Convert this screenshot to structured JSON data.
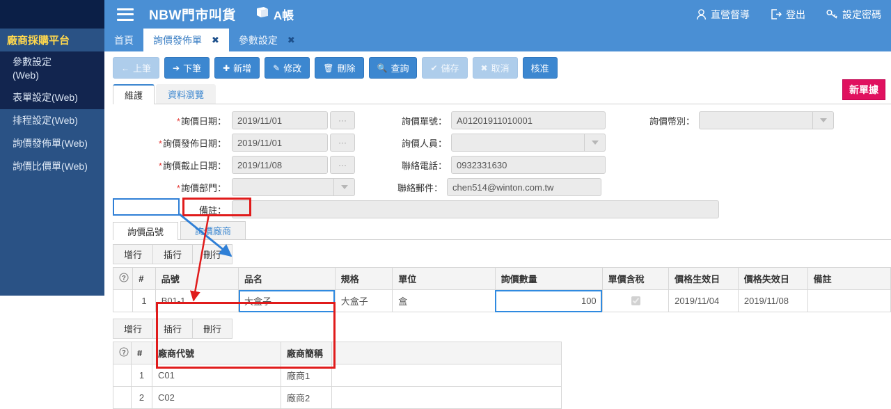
{
  "header": {
    "menu_icon": "hamburger-icon",
    "title": "NBW門市叫貨",
    "book_icon": "book-icon",
    "book_label": "A帳",
    "right_items": [
      {
        "icon": "user-icon",
        "label": "直營督導"
      },
      {
        "icon": "logout-icon",
        "label": "登出"
      },
      {
        "icon": "key-icon",
        "label": "設定密碼"
      }
    ]
  },
  "sidebar": {
    "platform": "廠商採購平台",
    "items": [
      {
        "label": "參數設定\n(Web)",
        "dark": true
      },
      {
        "label": "表單設定(Web)",
        "dark": true
      },
      {
        "label": "排程設定(Web)",
        "dark": false
      },
      {
        "label": "詢價發佈單(Web)",
        "dark": false
      },
      {
        "label": "詢價比價單(Web)",
        "dark": false
      }
    ]
  },
  "tabs": [
    {
      "label": "首頁",
      "active": false,
      "closable": false
    },
    {
      "label": "詢價發佈單",
      "active": true,
      "closable": true
    },
    {
      "label": "參數設定",
      "active": false,
      "closable": true
    }
  ],
  "toolbar": {
    "buttons": [
      {
        "icon": "arrow-left",
        "label": "上筆",
        "disabled": true
      },
      {
        "icon": "arrow-right",
        "label": "下筆",
        "disabled": false
      },
      {
        "icon": "plus",
        "label": "新增",
        "disabled": false
      },
      {
        "icon": "pencil",
        "label": "修改",
        "disabled": false
      },
      {
        "icon": "trash",
        "label": "刪除",
        "disabled": false
      },
      {
        "icon": "search",
        "label": "查詢",
        "disabled": false
      },
      {
        "icon": "check",
        "label": "儲存",
        "disabled": true
      },
      {
        "icon": "cross",
        "label": "取消",
        "disabled": true
      },
      {
        "icon": "",
        "label": "核准",
        "disabled": false
      }
    ]
  },
  "main_tabs": [
    {
      "label": "維護",
      "active": true
    },
    {
      "label": "資料瀏覽",
      "active": false
    }
  ],
  "badge": {
    "label": "新單據",
    "color": "#e0115f"
  },
  "form": {
    "left": [
      {
        "label": "詢價日期：",
        "required": true,
        "value": "2019/11/01",
        "control": "date"
      },
      {
        "label": "詢價發佈日期：",
        "required": true,
        "value": "2019/11/01",
        "control": "date"
      },
      {
        "label": "詢價截止日期：",
        "required": true,
        "value": "2019/11/08",
        "control": "date"
      },
      {
        "label": "詢價部門：",
        "required": true,
        "value": "",
        "control": "select"
      }
    ],
    "middle": [
      {
        "label": "詢價單號：",
        "required": false,
        "value": "A01201911010001",
        "control": "text"
      },
      {
        "label": "詢價人員：",
        "required": false,
        "value": "",
        "control": "select"
      },
      {
        "label": "聯絡電話：",
        "required": false,
        "value": "0932331630",
        "control": "text"
      },
      {
        "label": "聯絡郵件：",
        "required": false,
        "value": "chen514@winton.com.tw",
        "control": "text"
      }
    ],
    "right": [
      {
        "label": "詢價幣別：",
        "required": false,
        "value": "",
        "control": "select"
      }
    ],
    "memo": {
      "label": "備註：",
      "value": ""
    }
  },
  "item_section": {
    "subtabs": [
      {
        "label": "詢價品號",
        "active": true
      },
      {
        "label": "詢價廠商",
        "active": false
      }
    ],
    "row_buttons": [
      "增行",
      "插行",
      "刪行"
    ],
    "columns": [
      "",
      "#",
      "品號",
      "品名",
      "規格",
      "單位",
      "詢價數量",
      "單價含稅",
      "價格生效日",
      "價格失效日",
      "備註"
    ],
    "help_icon": "question-circle-icon",
    "rows": [
      {
        "no": "1",
        "品號": "B01-1",
        "品名": "大盒子",
        "規格": "大盒子",
        "單位": "盒",
        "詢價數量": "100",
        "單價含稅": true,
        "價格生效日": "2019/11/04",
        "價格失效日": "2019/11/08",
        "備註": ""
      }
    ]
  },
  "vendor_section": {
    "row_buttons": [
      "增行",
      "插行",
      "刪行"
    ],
    "columns": [
      "",
      "#",
      "廠商代號",
      "廠商簡稱",
      ""
    ],
    "help_icon": "question-circle-icon",
    "rows": [
      {
        "no": "1",
        "廠商代號": "C01",
        "廠商簡稱": "廠商1"
      },
      {
        "no": "2",
        "廠商代號": "C02",
        "廠商簡稱": "廠商2"
      }
    ]
  },
  "annotations": {
    "blue_color": "#2f7fd6",
    "red_color": "#e01b1b"
  }
}
